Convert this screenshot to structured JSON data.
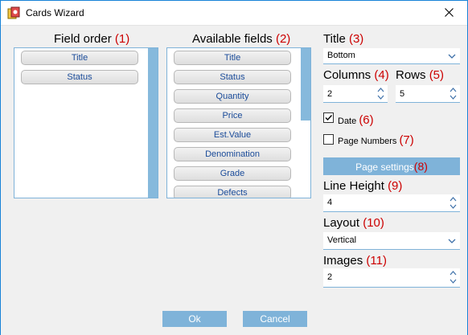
{
  "window": {
    "title": "Cards Wizard"
  },
  "field_order": {
    "label": "Field order",
    "number": "(1)",
    "items": [
      "Title",
      "Status"
    ]
  },
  "available_fields": {
    "label": "Available fields",
    "number": "(2)",
    "items": [
      "Title",
      "Status",
      "Quantity",
      "Price",
      "Est.Value",
      "Denomination",
      "Grade",
      "Defects"
    ]
  },
  "title_setting": {
    "label": "Title",
    "number": "(3)",
    "value": "Bottom"
  },
  "columns_setting": {
    "label": "Columns",
    "number": "(4)",
    "value": "2"
  },
  "rows_setting": {
    "label": "Rows",
    "number": "(5)",
    "value": "5"
  },
  "date_option": {
    "label": "Date",
    "number": "(6)",
    "checked": true
  },
  "page_numbers_option": {
    "label": "Page Numbers",
    "number": "(7)",
    "checked": false
  },
  "page_settings_button": {
    "label": "Page settings",
    "number": "(8)"
  },
  "line_height_setting": {
    "label": "Line Height",
    "number": "(9)",
    "value": "4"
  },
  "layout_setting": {
    "label": "Layout",
    "number": "(10)",
    "value": "Vertical"
  },
  "images_setting": {
    "label": "Images",
    "number": "(11)",
    "value": "2"
  },
  "footer": {
    "ok_label": "Ok",
    "cancel_label": "Cancel"
  },
  "colors": {
    "accent": "#7fb3d9",
    "number_red": "#cc0000",
    "pill_text": "#1a4b99"
  }
}
